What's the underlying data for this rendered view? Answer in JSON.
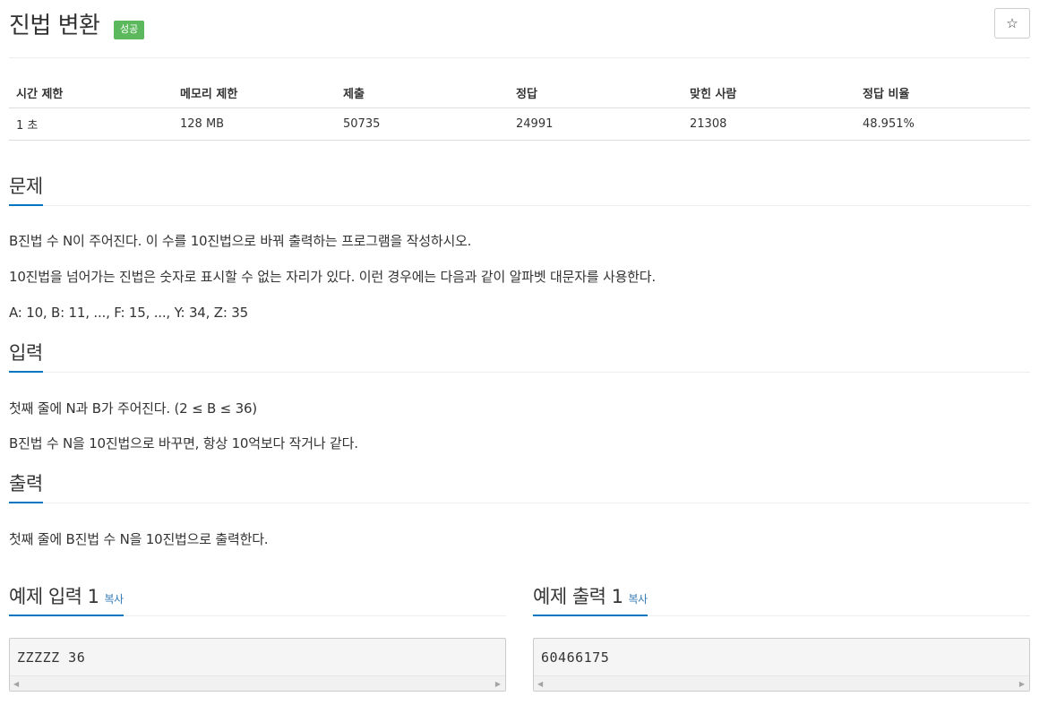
{
  "header": {
    "title": "진법 변환",
    "badge": "성공",
    "star_label": "☆"
  },
  "info_table": {
    "headers": [
      "시간 제한",
      "메모리 제한",
      "제출",
      "정답",
      "맞힌 사람",
      "정답 비율"
    ],
    "values": [
      "1 초",
      "128 MB",
      "50735",
      "24991",
      "21308",
      "48.951%"
    ]
  },
  "problem": {
    "heading": "문제",
    "lines": [
      "B진법 수 N이 주어진다. 이 수를 10진법으로 바꿔 출력하는 프로그램을 작성하시오.",
      "10진법을 넘어가는 진법은 숫자로 표시할 수 없는 자리가 있다. 이런 경우에는 다음과 같이 알파벳 대문자를 사용한다.",
      "A: 10, B: 11, ..., F: 15, ..., Y: 34, Z: 35"
    ]
  },
  "input": {
    "heading": "입력",
    "lines": [
      "첫째 줄에 N과 B가 주어진다. (2 ≤ B ≤ 36)",
      "B진법 수 N을 10진법으로 바꾸면, 항상 10억보다 작거나 같다."
    ]
  },
  "output": {
    "heading": "출력",
    "lines": [
      "첫째 줄에 B진법 수 N을 10진법으로 출력한다."
    ]
  },
  "samples": {
    "input": {
      "heading": "예제 입력 1",
      "copy_label": "복사",
      "content": "ZZZZZ 36"
    },
    "output": {
      "heading": "예제 출력 1",
      "copy_label": "복사",
      "content": "60466175"
    }
  }
}
